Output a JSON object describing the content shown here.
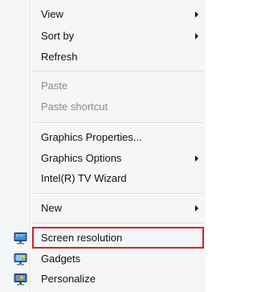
{
  "menu": {
    "items": [
      {
        "label": "View",
        "submenu": true
      },
      {
        "label": "Sort by",
        "submenu": true
      },
      {
        "label": "Refresh"
      },
      {
        "label": "Paste",
        "disabled": true
      },
      {
        "label": "Paste shortcut",
        "disabled": true
      },
      {
        "label": "Graphics Properties..."
      },
      {
        "label": "Graphics Options",
        "submenu": true
      },
      {
        "label": "Intel(R) TV Wizard"
      },
      {
        "label": "New",
        "submenu": true
      },
      {
        "label": "Screen resolution",
        "icon": "monitor-icon",
        "highlighted": true
      },
      {
        "label": "Gadgets",
        "icon": "gadgets-icon"
      },
      {
        "label": "Personalize",
        "icon": "personalize-icon"
      }
    ]
  },
  "colors": {
    "menu_bg": "#f5f6f7",
    "highlight_border": "#d6202a",
    "disabled_text": "#8b8b8b"
  }
}
